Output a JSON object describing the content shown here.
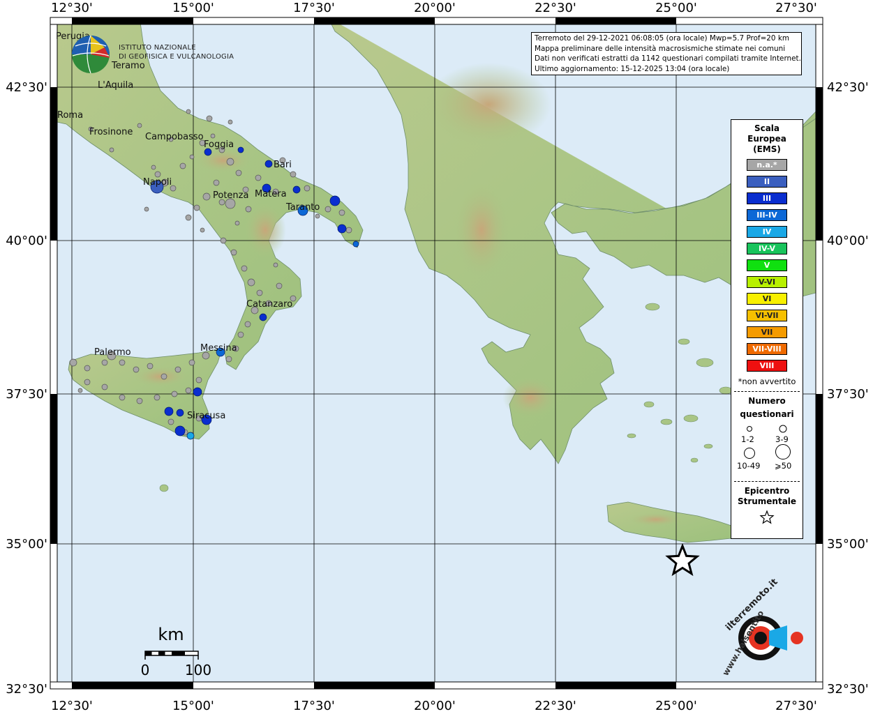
{
  "header": {
    "line1": "Terremoto del 29-12-2021 06:08:05 (ora locale) Mwp=5.7 Prof=20 km",
    "line2": "Mappa preliminare delle intensità macrosismiche stimate nei comuni",
    "line3": "Dati non verificati estratti da 1142 questionari compilati tramite Internet.",
    "line4": "Ultimo aggiornamento: 15-12-2025 13:04 (ora locale)"
  },
  "logo": {
    "line1": "ISTITUTO NAZIONALE",
    "line2": "DI GEOFISICA E VULCANOLOGIA"
  },
  "axes": {
    "top": [
      "12°30'",
      "15°00'",
      "17°30'",
      "20°00'",
      "22°30'",
      "25°00'",
      "27°30'"
    ],
    "bottom": [
      "12°30'",
      "15°00'",
      "17°30'",
      "20°00'",
      "22°30'",
      "25°00'",
      "27°30'"
    ],
    "left": [
      "42°30'",
      "40°00'",
      "37°30'",
      "35°00'",
      "32°30'"
    ],
    "right": [
      "42°30'",
      "40°00'",
      "37°30'",
      "35°00'",
      "32°30'"
    ]
  },
  "cities": [
    "Perugia",
    "Teramo",
    "L'Aquila",
    "Roma",
    "Frosinone",
    "Campobasso",
    "Foggia",
    "Bari",
    "Napoli",
    "Potenza",
    "Matera",
    "Taranto",
    "Catanzaro",
    "Messina",
    "Palermo",
    "Siracusa"
  ],
  "legend": {
    "title1": "Scala",
    "title2": "Europea",
    "title3": "(EMS)",
    "classes": [
      {
        "label": "n.a.*",
        "color": "#a6a6a6"
      },
      {
        "label": "II",
        "color": "#3b5fbf"
      },
      {
        "label": "III",
        "color": "#0a2ecf"
      },
      {
        "label": "III-IV",
        "color": "#0c68d6"
      },
      {
        "label": "IV",
        "color": "#1aa8e6"
      },
      {
        "label": "IV-V",
        "color": "#19c45c"
      },
      {
        "label": "V",
        "color": "#10e010"
      },
      {
        "label": "V-VI",
        "color": "#b8f000"
      },
      {
        "label": "VI",
        "color": "#f8f000"
      },
      {
        "label": "VI-VII",
        "color": "#f6c000"
      },
      {
        "label": "VII",
        "color": "#f59b00"
      },
      {
        "label": "VII-VIII",
        "color": "#ef6a00"
      },
      {
        "label": "VIII",
        "color": "#ee1010"
      }
    ],
    "note": "*non avvertito",
    "count_title1": "Numero",
    "count_title2": "questionari",
    "counts": [
      "1-2",
      "3-9",
      "10-49",
      "⩾50"
    ],
    "epi_title1": "Epicentro",
    "epi_title2": "Strumentale"
  },
  "scale": {
    "unit": "km",
    "start": "0",
    "end": "100"
  },
  "watermark": {
    "text1": "www.haisentito",
    "text2": "ilterremoto.it"
  },
  "colors": {
    "sea": "#dcebf7",
    "land_low": "#8fbf6a",
    "land_mid": "#d6c48f",
    "not_felt": "#a6a6a6",
    "intensity_ii": "#3b5fbf",
    "intensity_iii": "#0a2ecf"
  }
}
